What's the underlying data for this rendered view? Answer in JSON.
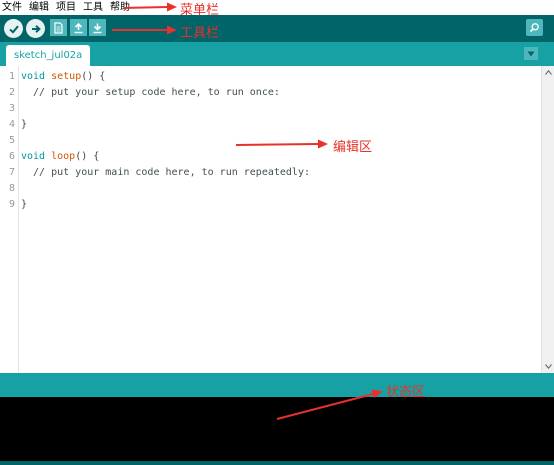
{
  "menubar": {
    "items": [
      "文件",
      "编辑",
      "项目",
      "工具",
      "帮助"
    ]
  },
  "toolbar": {
    "verify_icon": "checkmark-icon",
    "upload_icon": "right-arrow-icon",
    "new_icon": "new-file-icon",
    "open_icon": "open-arrow-up-icon",
    "save_icon": "save-arrow-down-icon",
    "serial_monitor_icon": "magnifier-icon"
  },
  "tabs": {
    "active": "sketch_jul02a",
    "menu_icon": "triangle-down-icon"
  },
  "editor": {
    "line_numbers": [
      "1",
      "2",
      "3",
      "4",
      "5",
      "6",
      "7",
      "8",
      "9"
    ],
    "lines": [
      {
        "kw": "void",
        "fn": "setup",
        "rest": "() {"
      },
      {
        "comment": "  // put your setup code here, to run once:"
      },
      {
        "comment": ""
      },
      {
        "plain": "}"
      },
      {
        "plain": ""
      },
      {
        "kw": "void",
        "fn": "loop",
        "rest": "() {"
      },
      {
        "comment": "  // put your main code here, to run repeatedly:"
      },
      {
        "comment": ""
      },
      {
        "plain": "}"
      }
    ]
  },
  "annotations": {
    "menu_bar": "菜单栏",
    "toolbar": "工具栏",
    "editor": "编辑区",
    "status": "状态区"
  },
  "colors": {
    "toolbar_bg": "#006468",
    "tab_bar_bg": "#17a1a5",
    "console_bg": "#000000",
    "annotation_red": "#e8312a"
  }
}
